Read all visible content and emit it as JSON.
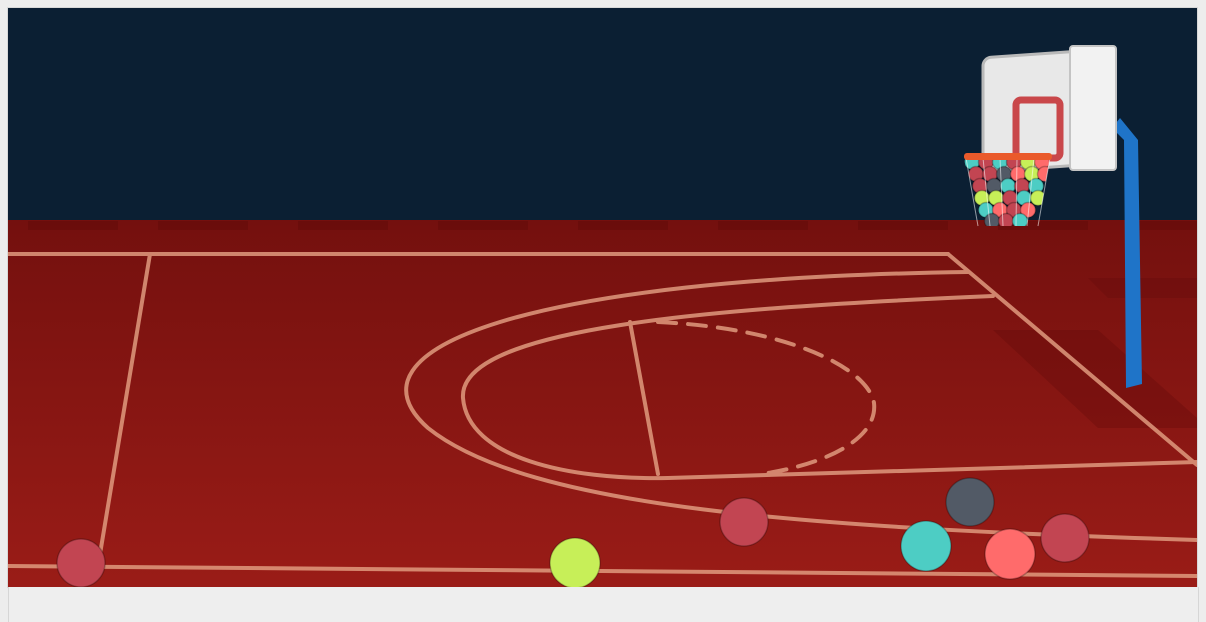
{
  "game": {
    "colors": {
      "wall": "#0b1f33",
      "floor": "#8e1613",
      "floor_light": "#9a1c17",
      "floor_dark": "#74100e",
      "court_lines": "#e09a7e",
      "backboard": "#e8e8e8",
      "backboard_edge": "#b9b9b9",
      "backboard_square": "#c9474a",
      "rim": "#ea5a2b",
      "pole": "#1f74c8"
    },
    "ball_palette": {
      "crimson": "#c24552",
      "lime": "#c7ef58",
      "teal": "#4dcdc4",
      "slate": "#525a66",
      "coral": "#ff6b6b"
    },
    "floor_balls": [
      {
        "color": "crimson"
      },
      {
        "color": "lime"
      },
      {
        "color": "crimson"
      },
      {
        "color": "slate"
      },
      {
        "color": "teal"
      },
      {
        "color": "coral"
      },
      {
        "color": "crimson"
      }
    ],
    "balls_in_hoop": [
      "teal",
      "crimson",
      "teal",
      "crimson",
      "lime",
      "coral",
      "crimson",
      "crimson",
      "slate",
      "coral",
      "lime",
      "coral",
      "crimson",
      "slate",
      "teal",
      "crimson",
      "teal",
      "lime",
      "lime",
      "crimson",
      "teal",
      "lime",
      "teal",
      "coral",
      "crimson",
      "coral",
      "slate",
      "crimson"
    ]
  }
}
